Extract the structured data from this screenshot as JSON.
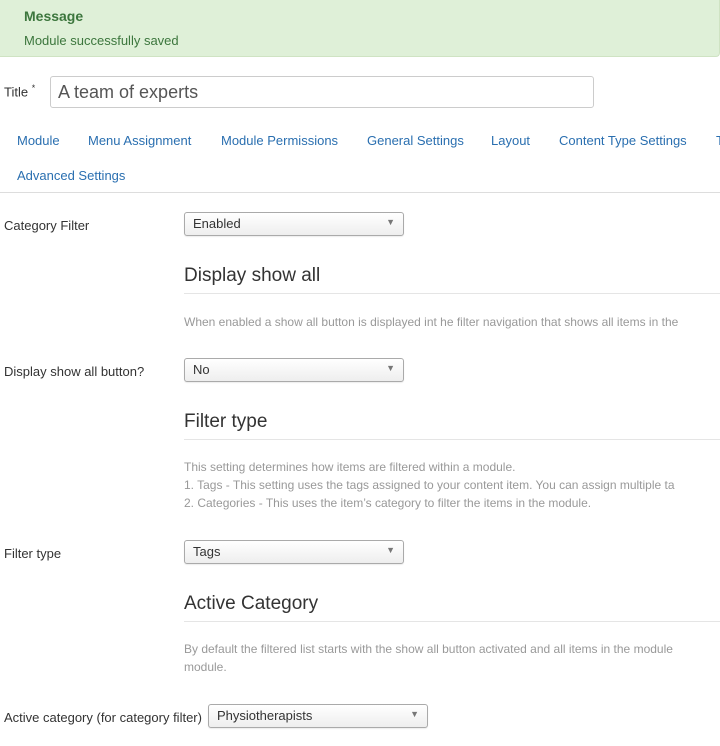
{
  "alert": {
    "heading": "Message",
    "text": "Module successfully saved"
  },
  "title_field": {
    "label": "Title",
    "required_mark": "*",
    "value": "A team of experts"
  },
  "tabs": [
    {
      "label": "Module"
    },
    {
      "label": "Menu Assignment"
    },
    {
      "label": "Module Permissions"
    },
    {
      "label": "General Settings"
    },
    {
      "label": "Layout"
    },
    {
      "label": "Content Type Settings"
    },
    {
      "label": "T"
    },
    {
      "label": "Advanced Settings"
    }
  ],
  "fields": {
    "category_filter": {
      "label": "Category Filter",
      "value": "Enabled"
    },
    "display_show_all": {
      "label": "Display show all button?",
      "value": "No"
    },
    "filter_type": {
      "label": "Filter type",
      "value": "Tags"
    },
    "active_category": {
      "label": "Active category (for category filter)",
      "value": "Physiotherapists"
    }
  },
  "sections": {
    "show_all": {
      "title": "Display show all",
      "desc": "When enabled a show all button is displayed int he filter navigation that shows all items in the"
    },
    "filter_type": {
      "title": "Filter type",
      "desc_lines": [
        "This setting determines how items are filtered within a module.",
        "1. Tags - This setting uses the tags assigned to your content item. You can assign multiple ta",
        "2. Categories - This uses the item’s category to filter the items in the module."
      ]
    },
    "active_category": {
      "title": "Active Category",
      "desc_lines": [
        "By default the filtered list starts with the show all button activated and all items in the module",
        "module."
      ]
    }
  },
  "icons": {
    "dropdown": "caret-down-icon"
  },
  "colors": {
    "alert_bg": "#dff0d8",
    "alert_text": "#3c763d",
    "link": "#2a6fb0"
  }
}
